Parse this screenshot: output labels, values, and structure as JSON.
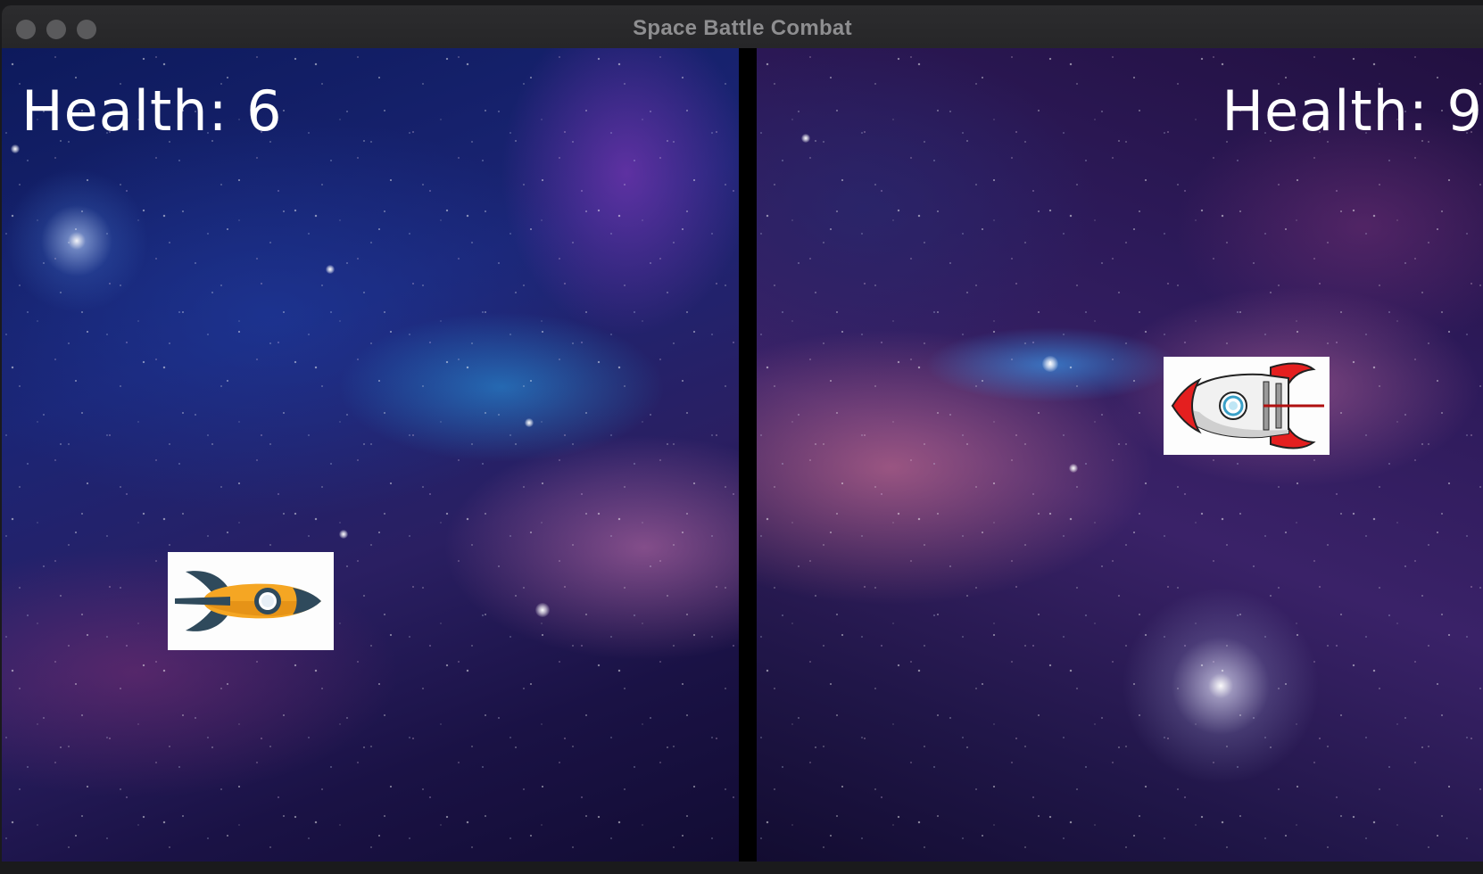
{
  "window": {
    "title": "Space Battle Combat"
  },
  "players": {
    "left": {
      "health_label": "Health: 6",
      "health": 6,
      "ship_color": "#f5a623"
    },
    "right": {
      "health_label": "Health: 9",
      "health": 9,
      "ship_color": "#e02020"
    }
  },
  "icons": {
    "left_ship": "yellow-rocket-icon",
    "right_ship": "red-white-rocket-icon"
  }
}
